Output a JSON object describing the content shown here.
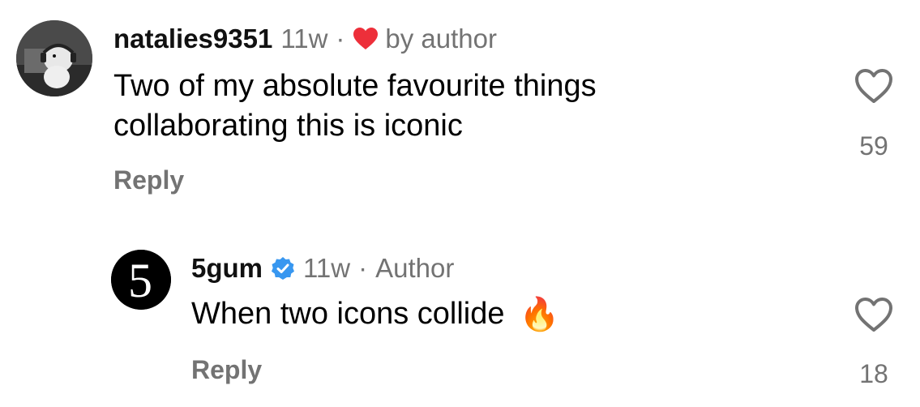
{
  "comments": [
    {
      "username": "natalies9351",
      "time": "11w",
      "separator": "·",
      "liked_label": "by author",
      "text_line1": "Two of my absolute favourite things",
      "text_line2": "collaborating  this is iconic",
      "reply_label": "Reply",
      "like_count": "59"
    },
    {
      "username": "5gum",
      "time": "11w",
      "separator": "·",
      "author_label": "Author",
      "text": "When two icons collide",
      "emoji": "🔥",
      "reply_label": "Reply",
      "like_count": "18",
      "avatar_logo_text": "5"
    }
  ],
  "colors": {
    "muted": "#737373",
    "heart_red": "#ed2f3a",
    "verified_blue": "#3897f0"
  }
}
